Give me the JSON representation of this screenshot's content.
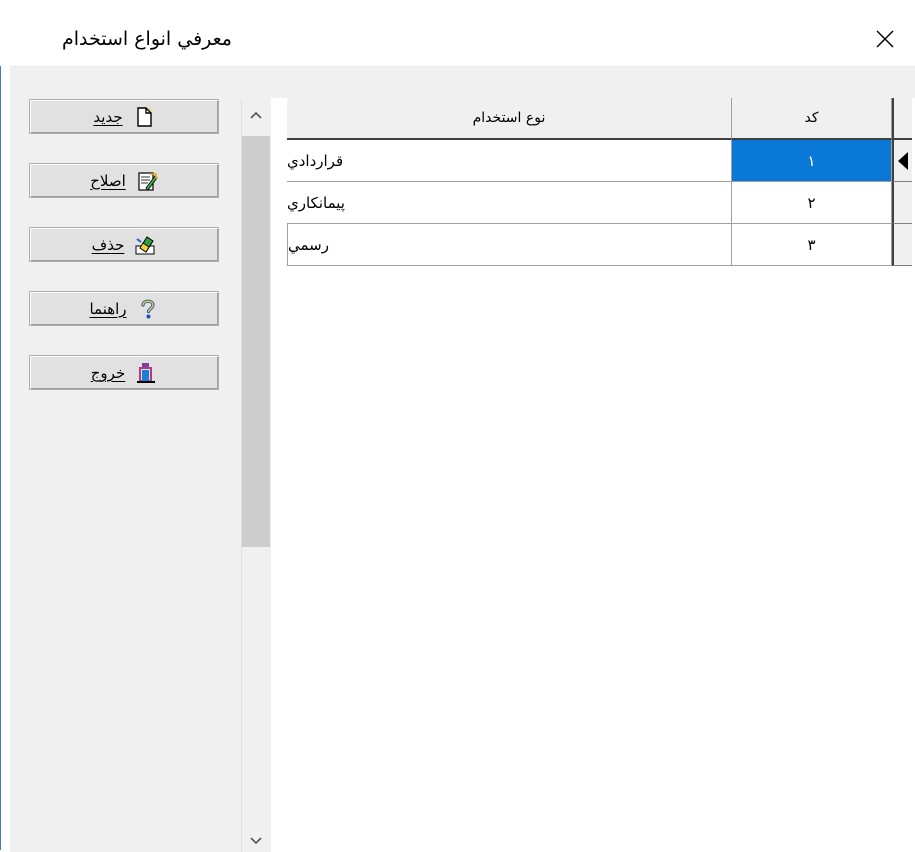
{
  "window": {
    "title": "معرفي انواع استخدام"
  },
  "toolbar": {
    "new_label": "جديد",
    "edit_label": "اصلاح",
    "delete_label": "حذف",
    "help_label": "راهنما",
    "exit_label": "خروج"
  },
  "grid": {
    "headers": {
      "code": "کد",
      "type": "نوع استخدام"
    },
    "rows": [
      {
        "code": "۱",
        "type": "قراردادي"
      },
      {
        "code": "۲",
        "type": "پيمانكاري"
      },
      {
        "code": "۳",
        "type": "رسمي"
      }
    ],
    "selected_row": 0
  },
  "colors": {
    "selection": "#0a78d7",
    "accent": "#3a7bd5"
  }
}
